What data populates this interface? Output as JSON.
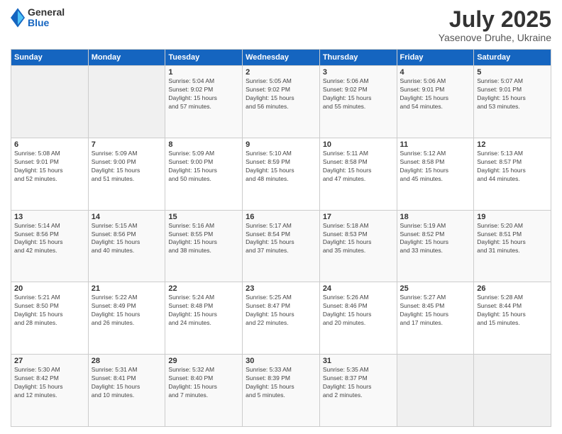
{
  "logo": {
    "general": "General",
    "blue": "Blue"
  },
  "title": "July 2025",
  "location": "Yasenove Druhe, Ukraine",
  "days_header": [
    "Sunday",
    "Monday",
    "Tuesday",
    "Wednesday",
    "Thursday",
    "Friday",
    "Saturday"
  ],
  "weeks": [
    [
      {
        "day": "",
        "info": ""
      },
      {
        "day": "",
        "info": ""
      },
      {
        "day": "1",
        "info": "Sunrise: 5:04 AM\nSunset: 9:02 PM\nDaylight: 15 hours\nand 57 minutes."
      },
      {
        "day": "2",
        "info": "Sunrise: 5:05 AM\nSunset: 9:02 PM\nDaylight: 15 hours\nand 56 minutes."
      },
      {
        "day": "3",
        "info": "Sunrise: 5:06 AM\nSunset: 9:02 PM\nDaylight: 15 hours\nand 55 minutes."
      },
      {
        "day": "4",
        "info": "Sunrise: 5:06 AM\nSunset: 9:01 PM\nDaylight: 15 hours\nand 54 minutes."
      },
      {
        "day": "5",
        "info": "Sunrise: 5:07 AM\nSunset: 9:01 PM\nDaylight: 15 hours\nand 53 minutes."
      }
    ],
    [
      {
        "day": "6",
        "info": "Sunrise: 5:08 AM\nSunset: 9:01 PM\nDaylight: 15 hours\nand 52 minutes."
      },
      {
        "day": "7",
        "info": "Sunrise: 5:09 AM\nSunset: 9:00 PM\nDaylight: 15 hours\nand 51 minutes."
      },
      {
        "day": "8",
        "info": "Sunrise: 5:09 AM\nSunset: 9:00 PM\nDaylight: 15 hours\nand 50 minutes."
      },
      {
        "day": "9",
        "info": "Sunrise: 5:10 AM\nSunset: 8:59 PM\nDaylight: 15 hours\nand 48 minutes."
      },
      {
        "day": "10",
        "info": "Sunrise: 5:11 AM\nSunset: 8:58 PM\nDaylight: 15 hours\nand 47 minutes."
      },
      {
        "day": "11",
        "info": "Sunrise: 5:12 AM\nSunset: 8:58 PM\nDaylight: 15 hours\nand 45 minutes."
      },
      {
        "day": "12",
        "info": "Sunrise: 5:13 AM\nSunset: 8:57 PM\nDaylight: 15 hours\nand 44 minutes."
      }
    ],
    [
      {
        "day": "13",
        "info": "Sunrise: 5:14 AM\nSunset: 8:56 PM\nDaylight: 15 hours\nand 42 minutes."
      },
      {
        "day": "14",
        "info": "Sunrise: 5:15 AM\nSunset: 8:56 PM\nDaylight: 15 hours\nand 40 minutes."
      },
      {
        "day": "15",
        "info": "Sunrise: 5:16 AM\nSunset: 8:55 PM\nDaylight: 15 hours\nand 38 minutes."
      },
      {
        "day": "16",
        "info": "Sunrise: 5:17 AM\nSunset: 8:54 PM\nDaylight: 15 hours\nand 37 minutes."
      },
      {
        "day": "17",
        "info": "Sunrise: 5:18 AM\nSunset: 8:53 PM\nDaylight: 15 hours\nand 35 minutes."
      },
      {
        "day": "18",
        "info": "Sunrise: 5:19 AM\nSunset: 8:52 PM\nDaylight: 15 hours\nand 33 minutes."
      },
      {
        "day": "19",
        "info": "Sunrise: 5:20 AM\nSunset: 8:51 PM\nDaylight: 15 hours\nand 31 minutes."
      }
    ],
    [
      {
        "day": "20",
        "info": "Sunrise: 5:21 AM\nSunset: 8:50 PM\nDaylight: 15 hours\nand 28 minutes."
      },
      {
        "day": "21",
        "info": "Sunrise: 5:22 AM\nSunset: 8:49 PM\nDaylight: 15 hours\nand 26 minutes."
      },
      {
        "day": "22",
        "info": "Sunrise: 5:24 AM\nSunset: 8:48 PM\nDaylight: 15 hours\nand 24 minutes."
      },
      {
        "day": "23",
        "info": "Sunrise: 5:25 AM\nSunset: 8:47 PM\nDaylight: 15 hours\nand 22 minutes."
      },
      {
        "day": "24",
        "info": "Sunrise: 5:26 AM\nSunset: 8:46 PM\nDaylight: 15 hours\nand 20 minutes."
      },
      {
        "day": "25",
        "info": "Sunrise: 5:27 AM\nSunset: 8:45 PM\nDaylight: 15 hours\nand 17 minutes."
      },
      {
        "day": "26",
        "info": "Sunrise: 5:28 AM\nSunset: 8:44 PM\nDaylight: 15 hours\nand 15 minutes."
      }
    ],
    [
      {
        "day": "27",
        "info": "Sunrise: 5:30 AM\nSunset: 8:42 PM\nDaylight: 15 hours\nand 12 minutes."
      },
      {
        "day": "28",
        "info": "Sunrise: 5:31 AM\nSunset: 8:41 PM\nDaylight: 15 hours\nand 10 minutes."
      },
      {
        "day": "29",
        "info": "Sunrise: 5:32 AM\nSunset: 8:40 PM\nDaylight: 15 hours\nand 7 minutes."
      },
      {
        "day": "30",
        "info": "Sunrise: 5:33 AM\nSunset: 8:39 PM\nDaylight: 15 hours\nand 5 minutes."
      },
      {
        "day": "31",
        "info": "Sunrise: 5:35 AM\nSunset: 8:37 PM\nDaylight: 15 hours\nand 2 minutes."
      },
      {
        "day": "",
        "info": ""
      },
      {
        "day": "",
        "info": ""
      }
    ]
  ]
}
